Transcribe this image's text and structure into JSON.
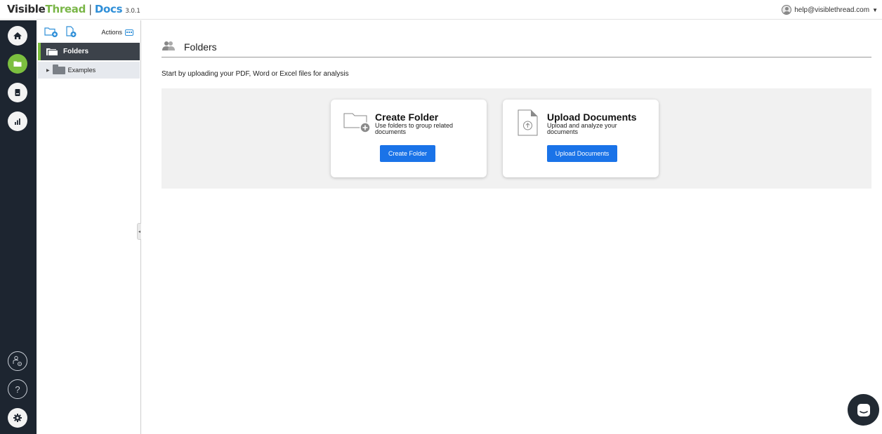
{
  "header": {
    "brand_part1": "Visible",
    "brand_part2": "Thread",
    "separator": "|",
    "product": "Docs",
    "version": "3.0.1",
    "user_email": "help@visiblethread.com"
  },
  "rail": {
    "items": [
      "home-icon",
      "folder-icon",
      "document-icon",
      "chart-icon"
    ],
    "bottom_items": [
      "user-settings-icon",
      "help-icon",
      "gear-icon"
    ],
    "active_color": "#7cbf3f",
    "bg_color": "#1d2530"
  },
  "folder_panel": {
    "actions_label": "Actions",
    "root_label": "Folders",
    "children": [
      {
        "label": "Examples"
      }
    ]
  },
  "main": {
    "title": "Folders",
    "intro": "Start by uploading your PDF, Word or Excel files for analysis",
    "cards": [
      {
        "title": "Create Folder",
        "description": "Use folders to group related documents",
        "button": "Create Folder"
      },
      {
        "title": "Upload Documents",
        "description": "Upload and analyze your documents",
        "button": "Upload Documents"
      }
    ]
  },
  "colors": {
    "accent_blue": "#1a73e8",
    "brand_green": "#7ab648",
    "brand_blue": "#2f8fd8"
  }
}
